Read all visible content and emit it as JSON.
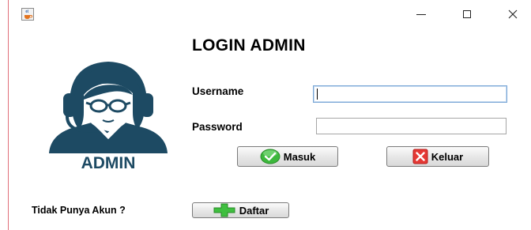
{
  "window": {
    "icons": {
      "app": "java-cup-icon",
      "minimize": "minimize-icon",
      "maximize": "maximize-icon",
      "close": "close-icon"
    }
  },
  "login": {
    "title": "LOGIN ADMIN",
    "avatar_caption": "ADMIN",
    "username_label": "Username",
    "username_value": "",
    "password_label": "Password",
    "password_value": ""
  },
  "buttons": {
    "masuk": "Masuk",
    "keluar": "Keluar",
    "daftar": "Daftar"
  },
  "footer": {
    "no_account_label": "Tidak Punya Akun ?"
  },
  "colors": {
    "avatar": "#1d4a63",
    "masuk_icon": "#3cb83c",
    "keluar_icon": "#e53935",
    "daftar_icon": "#3fbf3f"
  }
}
